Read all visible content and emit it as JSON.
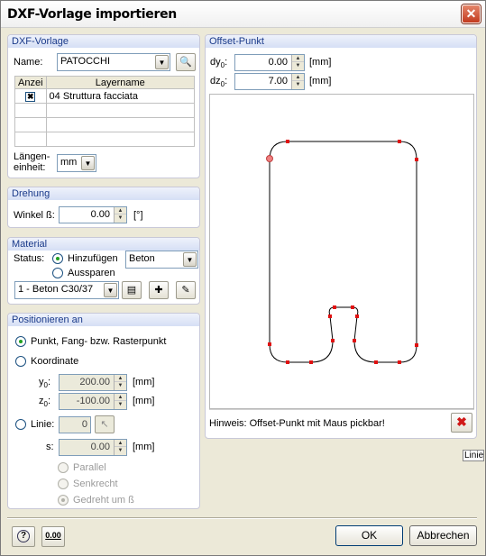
{
  "window": {
    "title": "DXF-Vorlage importieren",
    "close_label": "✕"
  },
  "dxf": {
    "header": "DXF-Vorlage",
    "name_label": "Name:",
    "name_value": "PATOCCHI",
    "col_anzei": "Anzei",
    "col_layername": "Layername",
    "rows": [
      {
        "checked": "✖",
        "name": "04 Struttura facciata"
      },
      {
        "checked": "",
        "name": ""
      },
      {
        "checked": "",
        "name": ""
      },
      {
        "checked": "",
        "name": ""
      }
    ],
    "unit_label_1": "Längen-",
    "unit_label_2": "einheit:",
    "unit_value": "mm"
  },
  "drehung": {
    "header": "Drehung",
    "winkel_label": "Winkel ß:",
    "winkel_value": "0.00",
    "unit": "[°]"
  },
  "material": {
    "header": "Material",
    "status_label": "Status:",
    "opt_add": "Hinzufügen",
    "opt_cut": "Aussparen",
    "type_value": "Beton",
    "material_value": "1 - Beton C30/37"
  },
  "position": {
    "header": "Positionieren an",
    "opt_point": "Punkt, Fang- bzw. Rasterpunkt",
    "opt_coord": "Koordinate",
    "y_label": "y",
    "y_sub": "0",
    "y_value": "200.00",
    "z_label": "z",
    "z_sub": "0",
    "z_value": "-100.00",
    "unit_mm": "[mm]",
    "opt_line": "Linie:",
    "line_value": "0",
    "s_label": "s:",
    "s_value": "0.00",
    "opt_parallel": "Parallel",
    "opt_senkrecht": "Senkrecht",
    "opt_gedreht": "Gedreht um ß"
  },
  "offset": {
    "header": "Offset-Punkt",
    "dy_label": "dy",
    "dy_sub": "0",
    "dy_value": "0.00",
    "dz_label": "dz",
    "dz_sub": "0",
    "dz_value": "7.00",
    "unit_mm": "[mm]",
    "hint": "Hinweis: Offset-Punkt mit Maus pickbar!"
  },
  "side_fragment": "Linie",
  "footer": {
    "ok": "OK",
    "cancel": "Abbrechen",
    "units_icon_text": "0.00"
  },
  "colors": {
    "group_header_text": "#1a3a8a",
    "shape_point": "#e01010",
    "close_button": "#c23a1e"
  }
}
